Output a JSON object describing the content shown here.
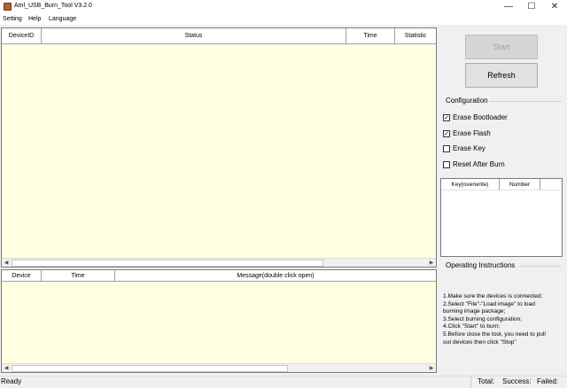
{
  "window": {
    "title": "Aml_USB_Burn_Tool V3.2.0",
    "minimize_glyph": "—",
    "maximize_glyph": "☐",
    "close_glyph": "✕",
    "icon": "app-icon"
  },
  "menu": {
    "items": [
      "Setting",
      "Help",
      "Language"
    ]
  },
  "device_table": {
    "columns": [
      "DeviceID",
      "Status",
      "Time",
      "Statistic"
    ]
  },
  "message_table": {
    "columns": [
      "Device",
      "Time",
      "Message(double click open)"
    ]
  },
  "buttons": {
    "start": "Start",
    "refresh": "Refresh"
  },
  "configuration": {
    "label": "Configuration",
    "options": [
      {
        "label": "Erase Bootloader",
        "checked": true
      },
      {
        "label": "Erase Flash",
        "checked": true
      },
      {
        "label": "Erase Key",
        "checked": false
      },
      {
        "label": "Reset After Burn",
        "checked": false
      }
    ]
  },
  "key_table": {
    "columns": [
      "Key(overwrite)",
      "Number"
    ]
  },
  "instructions": {
    "label": "Operating Instructions",
    "lines": [
      "1.Make sure the devices is connected;",
      "2.Select \"File\"-\"Load image\" to load",
      "burning image package;",
      "3.Select burning configuration;",
      "4.Click \"Start\" to burn;",
      "5.Before close the tool, you need to pull",
      "out devices then click \"Stop\""
    ]
  },
  "status": {
    "ready": "Ready",
    "total": "Total:",
    "success": "Success:",
    "failed": "Failed:"
  }
}
